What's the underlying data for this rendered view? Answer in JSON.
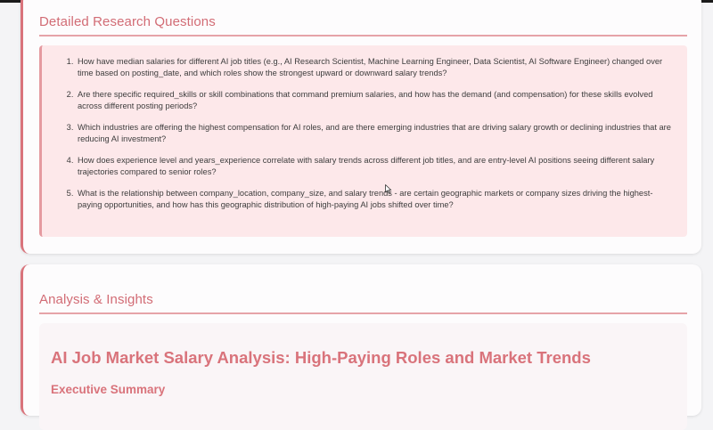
{
  "research_section": {
    "title": "Detailed Research Questions",
    "questions": [
      "How have median salaries for different AI job titles (e.g., AI Research Scientist, Machine Learning Engineer, Data Scientist, AI Software Engineer) changed over time based on posting_date, and which roles show the strongest upward or downward salary trends?",
      "Are there specific required_skills or skill combinations that command premium salaries, and how has the demand (and compensation) for these skills evolved across different posting periods?",
      "Which industries are offering the highest compensation for AI roles, and are there emerging industries that are driving salary growth or declining industries that are reducing AI investment?",
      "How does experience level and years_experience correlate with salary trends across different job titles, and are entry-level AI positions seeing different salary trajectories compared to senior roles?",
      "What is the relationship between company_location, company_size, and salary trends - are certain geographic markets or company sizes driving the highest-paying opportunities, and how has this geographic distribution of high-paying AI jobs shifted over time?"
    ]
  },
  "analysis_section": {
    "title": "Analysis & Insights",
    "report_title": "AI Job Market Salary Analysis: High-Paying Roles and Market Trends",
    "report_subtitle": "Executive Summary"
  },
  "colors": {
    "accent": "#d9737b",
    "question_bg": "#fde8ea",
    "card_bg": "#fdfcfd",
    "page_bg": "#f4f4f6"
  },
  "icons": {
    "cursor": "mouse-pointer-icon"
  }
}
